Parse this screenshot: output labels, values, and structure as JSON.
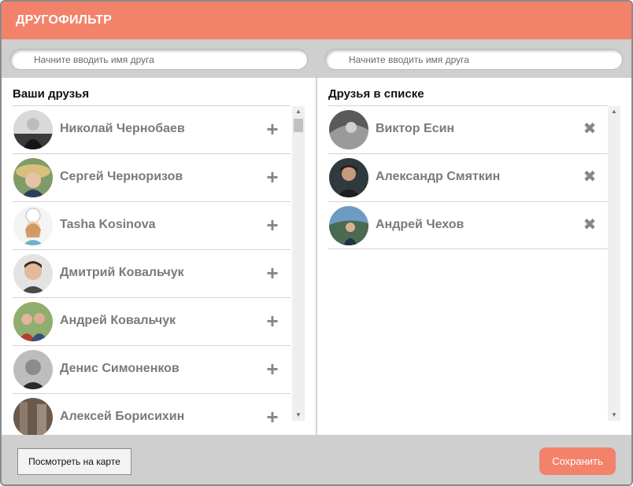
{
  "header": {
    "title": "ДРУГОФИЛЬТР"
  },
  "search": {
    "left_placeholder": "Начните вводить имя друга",
    "right_placeholder": "Начните вводить имя друга"
  },
  "your_friends": {
    "heading": "Ваши друзья",
    "items": [
      {
        "name": "Николай Чернобаев",
        "action": "+"
      },
      {
        "name": "Сергей Черноризов",
        "action": "+"
      },
      {
        "name": "Tasha Kosinova",
        "action": "+"
      },
      {
        "name": "Дмитрий Ковальчук",
        "action": "+"
      },
      {
        "name": "Андрей Ковальчук",
        "action": "+"
      },
      {
        "name": "Денис Симоненков",
        "action": "+"
      },
      {
        "name": "Алексей Борисихин",
        "action": "+"
      }
    ]
  },
  "listed_friends": {
    "heading": "Друзья в списке",
    "items": [
      {
        "name": "Виктор Есин",
        "action": "✖"
      },
      {
        "name": "Александр Смяткин",
        "action": "✖"
      },
      {
        "name": "Андрей Чехов",
        "action": "✖"
      }
    ]
  },
  "footer": {
    "map_label": "Посмотреть на карте",
    "save_label": "Сохранить"
  },
  "colors": {
    "accent": "#f3826b",
    "background": "#cfcfcf",
    "name_text": "#7a7a7a"
  },
  "icons": {
    "add": "plus-icon",
    "remove": "close-icon",
    "scroll_up": "scroll-up-arrow-icon",
    "scroll_down": "scroll-down-arrow-icon"
  }
}
